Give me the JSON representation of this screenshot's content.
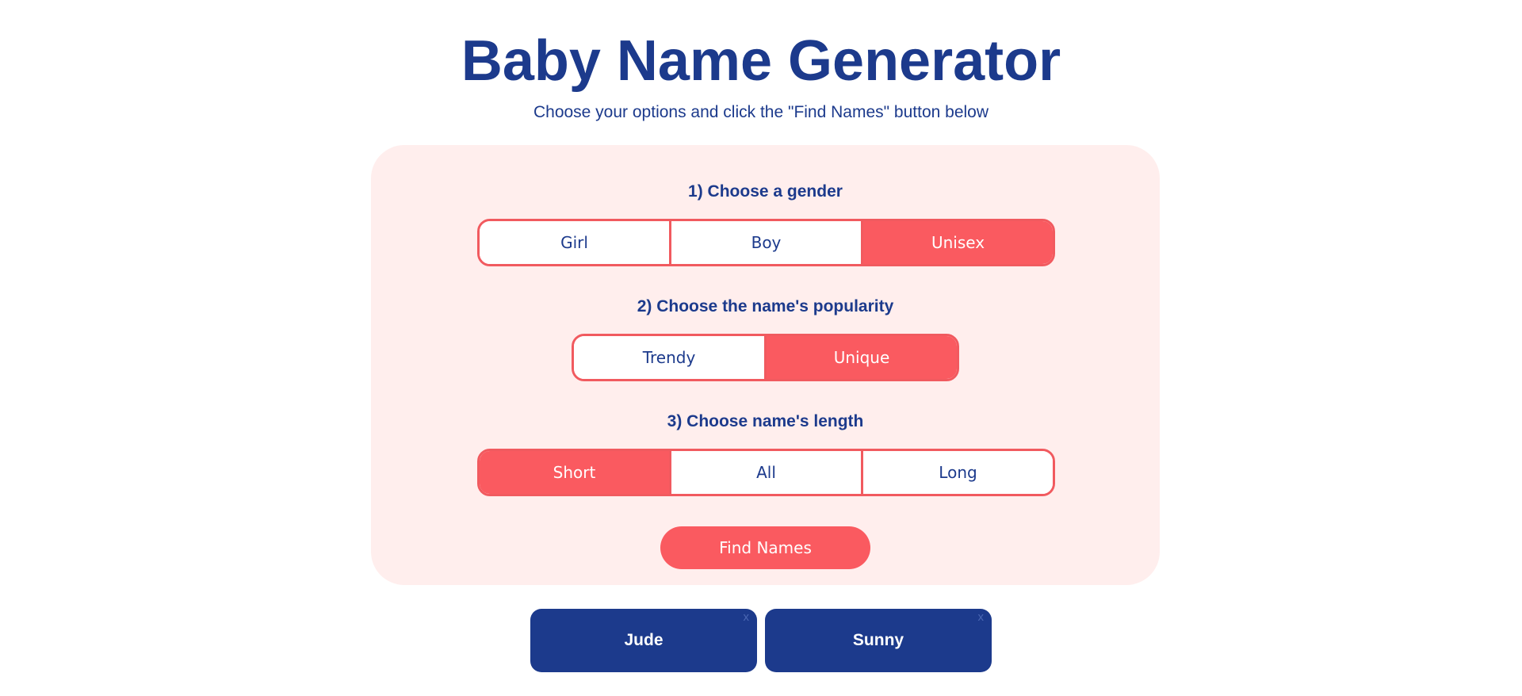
{
  "header": {
    "title": "Baby Name Generator",
    "subtitle": "Choose your options and click the \"Find Names\" button below"
  },
  "form": {
    "gender": {
      "label": "1) Choose a gender",
      "options": [
        "Girl",
        "Boy",
        "Unisex"
      ],
      "selected": "Unisex"
    },
    "popularity": {
      "label": "2) Choose the name's popularity",
      "options": [
        "Trendy",
        "Unique"
      ],
      "selected": "Unique"
    },
    "length": {
      "label": "3) Choose name's length",
      "options": [
        "Short",
        "All",
        "Long"
      ],
      "selected": "Short"
    },
    "submit_label": "Find Names"
  },
  "results": {
    "names": [
      "Jude",
      "Sunny"
    ],
    "remove_label": "x"
  },
  "colors": {
    "navy": "#1c3a8c",
    "coral": "#fa5a60",
    "panel_bg": "#ffeeed"
  }
}
